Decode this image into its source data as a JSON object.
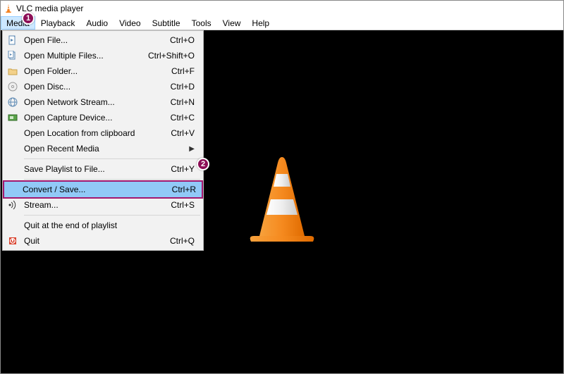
{
  "window": {
    "title": "VLC media player"
  },
  "menubar": {
    "items": [
      "Media",
      "Playback",
      "Audio",
      "Video",
      "Subtitle",
      "Tools",
      "View",
      "Help"
    ],
    "active_index": 0
  },
  "dropdown": {
    "rows": [
      {
        "icon": "file",
        "label": "Open File...",
        "shortcut": "Ctrl+O"
      },
      {
        "icon": "files",
        "label": "Open Multiple Files...",
        "shortcut": "Ctrl+Shift+O"
      },
      {
        "icon": "folder",
        "label": "Open Folder...",
        "shortcut": "Ctrl+F"
      },
      {
        "icon": "disc",
        "label": "Open Disc...",
        "shortcut": "Ctrl+D"
      },
      {
        "icon": "network",
        "label": "Open Network Stream...",
        "shortcut": "Ctrl+N"
      },
      {
        "icon": "capture",
        "label": "Open Capture Device...",
        "shortcut": "Ctrl+C"
      },
      {
        "icon": "",
        "label": "Open Location from clipboard",
        "shortcut": "Ctrl+V"
      },
      {
        "icon": "",
        "label": "Open Recent Media",
        "submenu": true
      },
      {
        "sep": true
      },
      {
        "icon": "",
        "label": "Save Playlist to File...",
        "shortcut": "Ctrl+Y"
      },
      {
        "sep": true
      },
      {
        "icon": "",
        "label": "Convert / Save...",
        "shortcut": "Ctrl+R",
        "highlight": true
      },
      {
        "icon": "stream",
        "label": "Stream...",
        "shortcut": "Ctrl+S"
      },
      {
        "sep": true
      },
      {
        "icon": "",
        "label": "Quit at the end of playlist"
      },
      {
        "icon": "quit",
        "label": "Quit",
        "shortcut": "Ctrl+Q"
      }
    ]
  },
  "annotations": {
    "badge1": "1",
    "badge2": "2"
  }
}
